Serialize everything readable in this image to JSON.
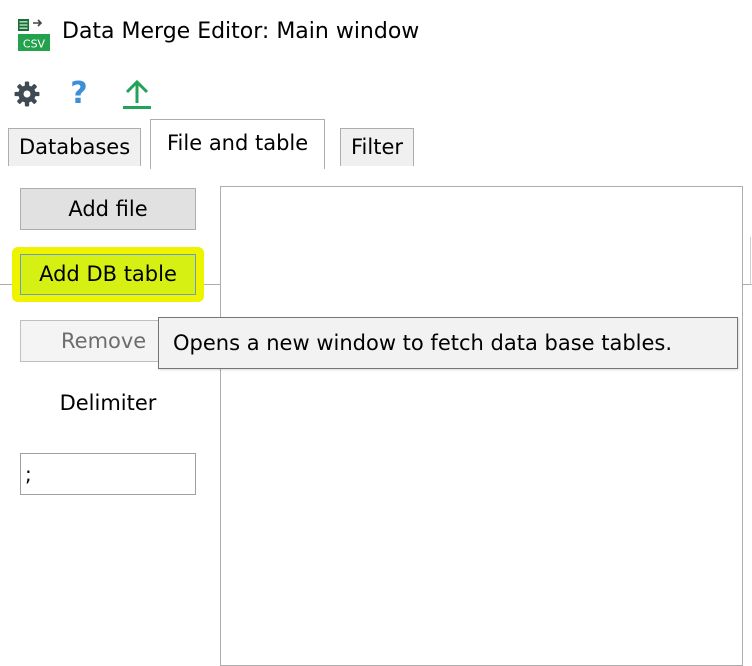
{
  "window": {
    "title": "Data Merge Editor: Main window"
  },
  "app_icon": {
    "name": "csv-icon",
    "text": "CSV"
  },
  "toolbar": {
    "settings_icon": "gear-icon",
    "help_label": "?",
    "upload_icon": "upload-icon"
  },
  "tabs": [
    {
      "label": "Databases",
      "selected": false
    },
    {
      "label": "File and table",
      "selected": true
    },
    {
      "label": "Filter",
      "selected": false
    }
  ],
  "file_panel": {
    "add_file_label": "Add file",
    "add_db_table_label": "Add DB table",
    "remove_label": "Remove",
    "delimiter_label": "Delimiter",
    "delimiter_value": ";"
  },
  "tooltip": {
    "text": "Opens a new window to fetch data base tables."
  },
  "colors": {
    "highlight": "#eef400",
    "help_blue": "#3d8fd6",
    "upload_green": "#21a35a",
    "gear_gray": "#3f4a54"
  }
}
